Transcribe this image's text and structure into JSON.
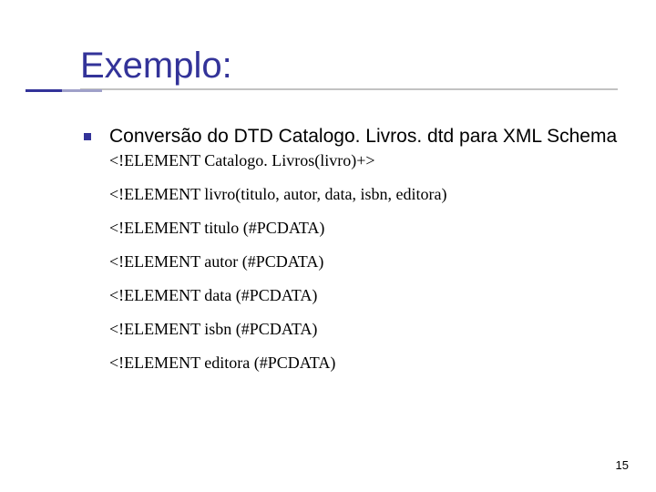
{
  "slide": {
    "title": "Exemplo:",
    "bullet_text": "Conversão do DTD Catalogo. Livros. dtd para XML Schema",
    "code_lines": [
      "<!ELEMENT Catalogo. Livros(livro)+>",
      "<!ELEMENT livro(titulo, autor, data, isbn, editora)",
      "<!ELEMENT titulo (#PCDATA)",
      "<!ELEMENT autor (#PCDATA)",
      "<!ELEMENT data (#PCDATA)",
      "<!ELEMENT isbn (#PCDATA)",
      "<!ELEMENT editora (#PCDATA)"
    ],
    "slide_number": "15"
  }
}
